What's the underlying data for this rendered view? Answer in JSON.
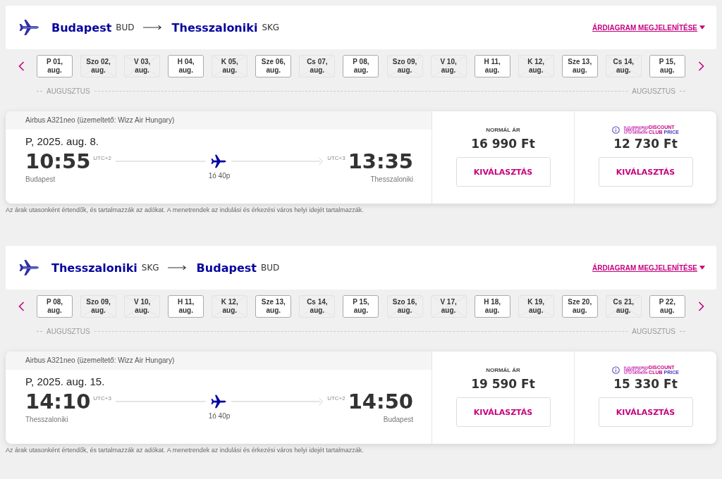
{
  "flights": [
    {
      "from": {
        "city": "Budapest",
        "code": "BUD"
      },
      "to": {
        "city": "Thesszaloniki",
        "code": "SKG"
      },
      "chart_link": "ÁRDIAGRAM MEGJELENÍTÉSE",
      "dates": [
        {
          "day": "P 01,",
          "month": "aug.",
          "available": true
        },
        {
          "day": "Szo 02,",
          "month": "aug.",
          "available": false
        },
        {
          "day": "V 03,",
          "month": "aug.",
          "available": false
        },
        {
          "day": "H 04,",
          "month": "aug.",
          "available": true
        },
        {
          "day": "K 05,",
          "month": "aug.",
          "available": false
        },
        {
          "day": "Sze 06,",
          "month": "aug.",
          "available": true
        },
        {
          "day": "Cs 07,",
          "month": "aug.",
          "available": false
        },
        {
          "day": "P 08,",
          "month": "aug.",
          "available": true
        },
        {
          "day": "Szo 09,",
          "month": "aug.",
          "available": false
        },
        {
          "day": "V 10,",
          "month": "aug.",
          "available": false
        },
        {
          "day": "H 11,",
          "month": "aug.",
          "available": true
        },
        {
          "day": "K 12,",
          "month": "aug.",
          "available": false
        },
        {
          "day": "Sze 13,",
          "month": "aug.",
          "available": true
        },
        {
          "day": "Cs 14,",
          "month": "aug.",
          "available": false
        },
        {
          "day": "P 15,",
          "month": "aug.",
          "available": true
        }
      ],
      "month_labels": [
        "AUGUSZTUS",
        "AUGUSZTUS"
      ],
      "aircraft": "Airbus A321neo (üzemeltető: Wizz Air Hungary)",
      "date": "P, 2025. aug. 8.",
      "departure": {
        "time": "10:55",
        "utc": "UTC+2",
        "city": "Budapest"
      },
      "duration": "1ó 40p",
      "arrival": {
        "time": "13:35",
        "utc": "UTC+3",
        "city": "Thesszaloniki"
      },
      "normal": {
        "label": "NORMÁL ÁR",
        "price": "16 990 Ft",
        "button": "KIVÁLASZTÁS"
      },
      "club": {
        "logo": "WIZZ",
        "tag_top": "DISCOUNT",
        "tag_club": "CLUB",
        "tag_price": "PRICE",
        "price": "12 730 Ft",
        "button": "KIVÁLASZTÁS"
      },
      "note": "Az árak utasonként értendők, és tartalmazzák az adókat. A menetrendek az indulási és érkezési város helyi idejét tartalmazzák."
    },
    {
      "from": {
        "city": "Thesszaloniki",
        "code": "SKG"
      },
      "to": {
        "city": "Budapest",
        "code": "BUD"
      },
      "chart_link": "ÁRDIAGRAM MEGJELENÍTÉSE",
      "dates": [
        {
          "day": "P 08,",
          "month": "aug.",
          "available": true
        },
        {
          "day": "Szo 09,",
          "month": "aug.",
          "available": false
        },
        {
          "day": "V 10,",
          "month": "aug.",
          "available": false
        },
        {
          "day": "H 11,",
          "month": "aug.",
          "available": true
        },
        {
          "day": "K 12,",
          "month": "aug.",
          "available": false
        },
        {
          "day": "Sze 13,",
          "month": "aug.",
          "available": true
        },
        {
          "day": "Cs 14,",
          "month": "aug.",
          "available": false
        },
        {
          "day": "P 15,",
          "month": "aug.",
          "available": true
        },
        {
          "day": "Szo 16,",
          "month": "aug.",
          "available": false
        },
        {
          "day": "V 17,",
          "month": "aug.",
          "available": false
        },
        {
          "day": "H 18,",
          "month": "aug.",
          "available": true
        },
        {
          "day": "K 19,",
          "month": "aug.",
          "available": false
        },
        {
          "day": "Sze 20,",
          "month": "aug.",
          "available": true
        },
        {
          "day": "Cs 21,",
          "month": "aug.",
          "available": false
        },
        {
          "day": "P 22,",
          "month": "aug.",
          "available": true
        }
      ],
      "month_labels": [
        "AUGUSZTUS",
        "AUGUSZTUS"
      ],
      "aircraft": "Airbus A321neo (üzemeltető: Wizz Air Hungary)",
      "date": "P, 2025. aug. 15.",
      "departure": {
        "time": "14:10",
        "utc": "UTC+3",
        "city": "Thesszaloniki"
      },
      "duration": "1ó 40p",
      "arrival": {
        "time": "14:50",
        "utc": "UTC+2",
        "city": "Budapest"
      },
      "normal": {
        "label": "NORMÁL ÁR",
        "price": "19 590 Ft",
        "button": "KIVÁLASZTÁS"
      },
      "club": {
        "logo": "WIZZ",
        "tag_top": "DISCOUNT",
        "tag_club": "CLUB",
        "tag_price": "PRICE",
        "price": "15 330 Ft",
        "button": "KIVÁLASZTÁS"
      },
      "note": "Az árak utasonként értendők, és tartalmazzák az adókat. A menetrendek az indulási és érkezési város helyi idejét tartalmazzák."
    }
  ]
}
